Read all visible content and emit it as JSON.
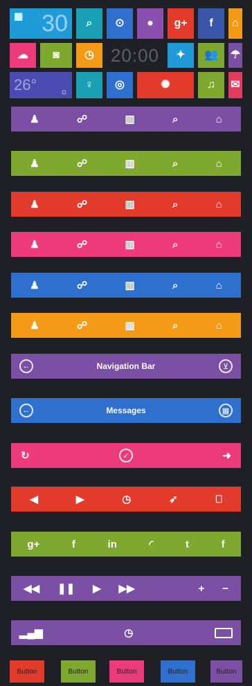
{
  "colors": {
    "purple": "#7b4fa4",
    "green": "#7ea82f",
    "red": "#e23b2c",
    "pink": "#ed3b7a",
    "blue": "#2f6fcd",
    "orange": "#f39a18",
    "teal": "#1aa0b4",
    "dark": "#2b2f3a"
  },
  "tiles": {
    "calendar_day": "30",
    "clock_time": "20:00",
    "temperature": "26°"
  },
  "grid_icons": [
    "calendar-icon",
    "search-icon",
    "play-icon",
    "map-pin-icon",
    "google-plus-icon",
    "facebook-icon",
    "lock-icon",
    "cloud-download-icon",
    "camera-icon",
    "clock-icon",
    "twitter-icon",
    "contacts-icon",
    "weather-icon",
    "microphone-icon",
    "compass-icon",
    "settings-icon",
    "bell-icon",
    "mail-icon",
    "sun-icon"
  ],
  "bars": {
    "nav_title": "Navigation Bar",
    "msg_title": "Messages"
  },
  "buttons": {
    "b1": "Button",
    "b2": "Button",
    "b3": "Button",
    "b4": "Button",
    "b5": "Button"
  }
}
